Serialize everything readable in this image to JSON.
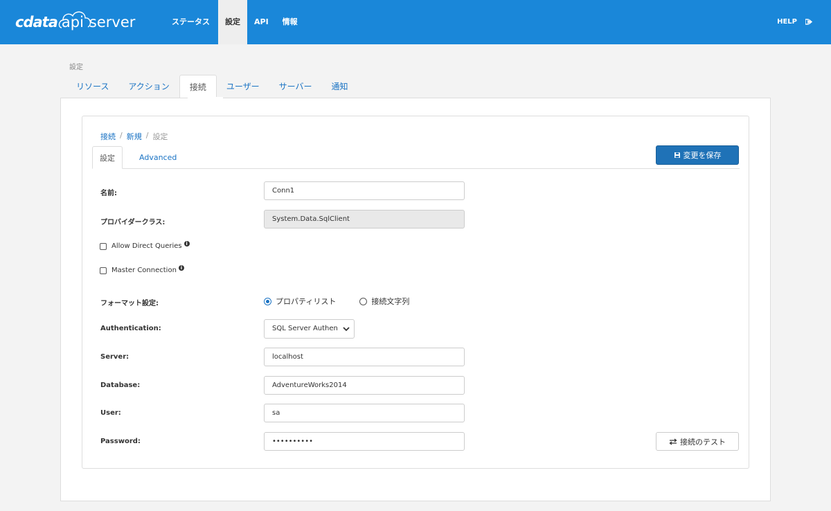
{
  "header": {
    "logo": {
      "cdata": "cdata",
      "api": "api",
      "server": "server"
    },
    "nav": [
      {
        "label": "ステータス",
        "active": false
      },
      {
        "label": "設定",
        "active": true
      },
      {
        "label": "API",
        "active": false
      },
      {
        "label": "情報",
        "active": false
      }
    ],
    "help": "HELP"
  },
  "page": {
    "label": "設定",
    "tabs": [
      {
        "label": "リソース",
        "active": false
      },
      {
        "label": "アクション",
        "active": false
      },
      {
        "label": "接続",
        "active": true
      },
      {
        "label": "ユーザー",
        "active": false
      },
      {
        "label": "サーバー",
        "active": false
      },
      {
        "label": "通知",
        "active": false
      }
    ]
  },
  "breadcrumb": {
    "items": [
      "接続",
      "新規",
      "設定"
    ],
    "sep": "/"
  },
  "subtabs": [
    {
      "label": "設定",
      "active": true
    },
    {
      "label": "Advanced",
      "active": false
    }
  ],
  "actions": {
    "save": "変更を保存",
    "test": "接続のテスト"
  },
  "form": {
    "name": {
      "label": "名前:",
      "value": "Conn1"
    },
    "provider": {
      "label": "プロバイダークラス:",
      "value": "System.Data.SqlClient"
    },
    "allow_direct": {
      "label": "Allow Direct Queries",
      "checked": false
    },
    "master": {
      "label": "Master Connection",
      "checked": false
    },
    "format": {
      "label": "フォーマット設定:",
      "options": [
        "プロパティリスト",
        "接続文字列"
      ],
      "selected": "プロパティリスト"
    },
    "auth": {
      "label": "Authentication:",
      "value": "SQL Server Authen"
    },
    "server": {
      "label": "Server:",
      "value": "localhost"
    },
    "database": {
      "label": "Database:",
      "value": "AdventureWorks2014"
    },
    "user": {
      "label": "User:",
      "value": "sa"
    },
    "password": {
      "label": "Password:",
      "value": "••••••••••"
    }
  },
  "colors": {
    "brand": "#1a87d9",
    "primary_button": "#1f72b7",
    "link": "#1a73c4"
  }
}
